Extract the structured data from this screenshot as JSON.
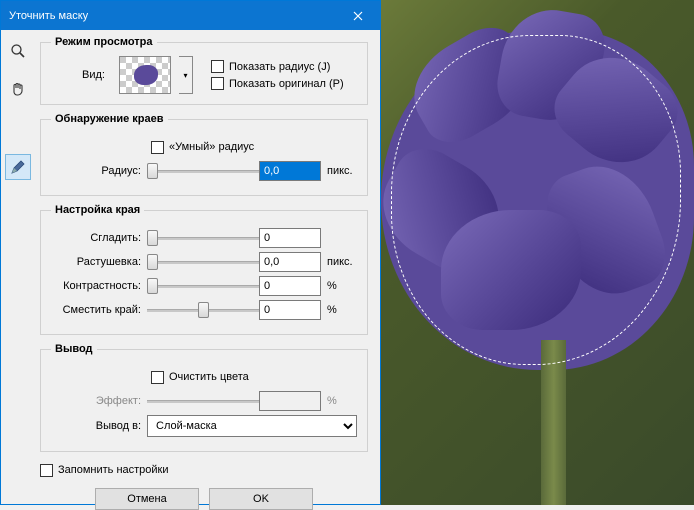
{
  "title": "Уточнить маску",
  "view": {
    "legend": "Режим просмотра",
    "view_label": "Вид:",
    "show_radius": "Показать радиус (J)",
    "show_original": "Показать оригинал (P)"
  },
  "edge": {
    "legend": "Обнаружение краев",
    "smart_radius": "«Умный» радиус",
    "radius_label": "Радиус:",
    "radius_value": "0,0",
    "radius_unit": "пикс."
  },
  "adjust": {
    "legend": "Настройка края",
    "smooth_label": "Сгладить:",
    "smooth_value": "0",
    "feather_label": "Растушевка:",
    "feather_value": "0,0",
    "feather_unit": "пикс.",
    "contrast_label": "Контрастность:",
    "contrast_value": "0",
    "contrast_unit": "%",
    "shift_label": "Сместить край:",
    "shift_value": "0",
    "shift_unit": "%"
  },
  "output": {
    "legend": "Вывод",
    "clean_colors": "Очистить цвета",
    "effect_label": "Эффект:",
    "effect_unit": "%",
    "output_to_label": "Вывод в:",
    "output_to_value": "Слой-маска"
  },
  "remember": "Запомнить настройки",
  "buttons": {
    "cancel": "Отмена",
    "ok": "OK"
  }
}
